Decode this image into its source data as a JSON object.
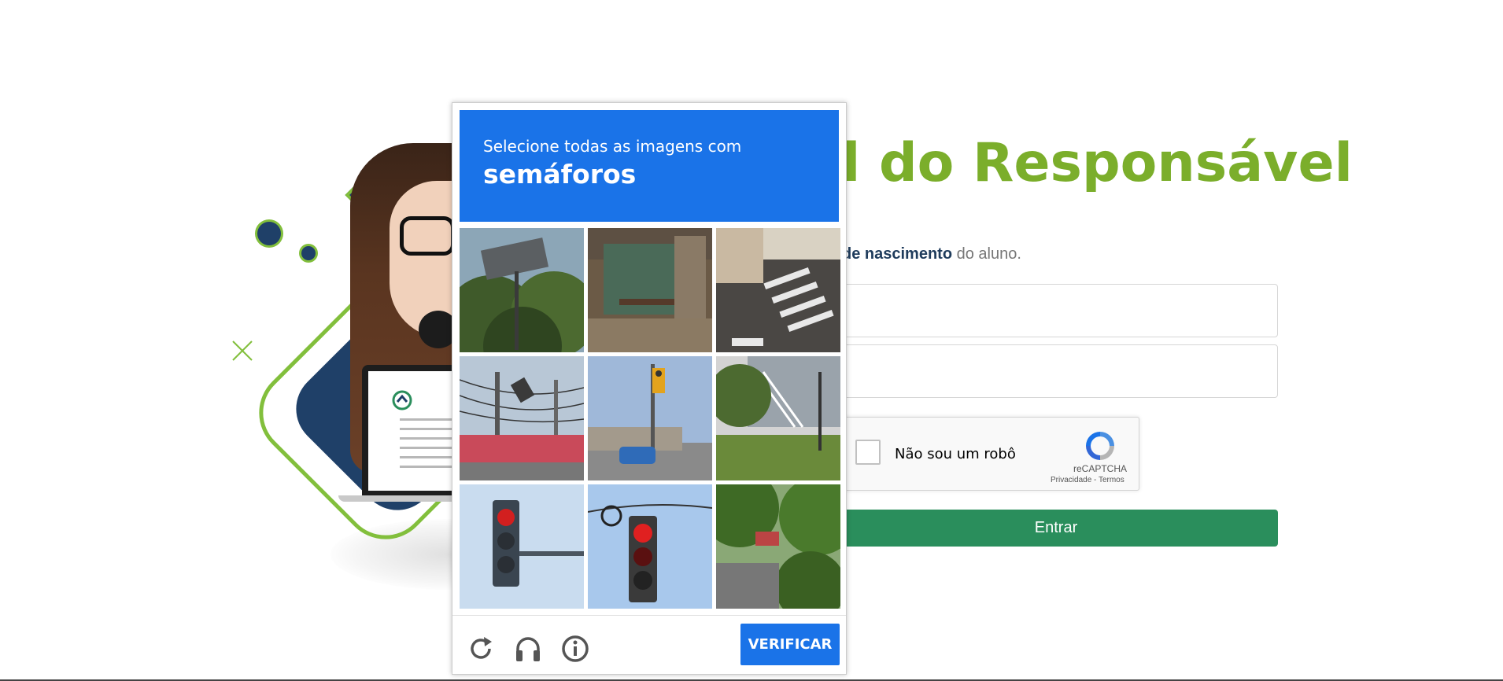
{
  "page": {
    "title": "l do Responsável",
    "instruction_bold": "de nascimento",
    "instruction_rest": " do aluno.",
    "submit_label": "Entrar"
  },
  "recaptcha": {
    "label": "Não sou um robô",
    "brand": "reCAPTCHA",
    "links": "Privacidade - Termos"
  },
  "challenge": {
    "prompt": "Selecione todas as imagens com",
    "object": "semáforos",
    "verify_label": "VERIFICAR",
    "tiles": [
      "tree-with-sign-tile",
      "bus-shelter-tile",
      "crosswalk-tile",
      "power-lines-traffic-light-tile",
      "intersection-traffic-light-tile",
      "house-stairs-tile",
      "red-traffic-light-tile",
      "hanging-red-traffic-light-tile",
      "street-trees-tile"
    ],
    "footer_icons": [
      "reload-icon",
      "audio-headphones-icon",
      "info-icon"
    ]
  },
  "colors": {
    "brand_green": "#7bae2b",
    "button_green": "#2a8e5c",
    "challenge_blue": "#1a73e8",
    "navy": "#1f4068"
  }
}
